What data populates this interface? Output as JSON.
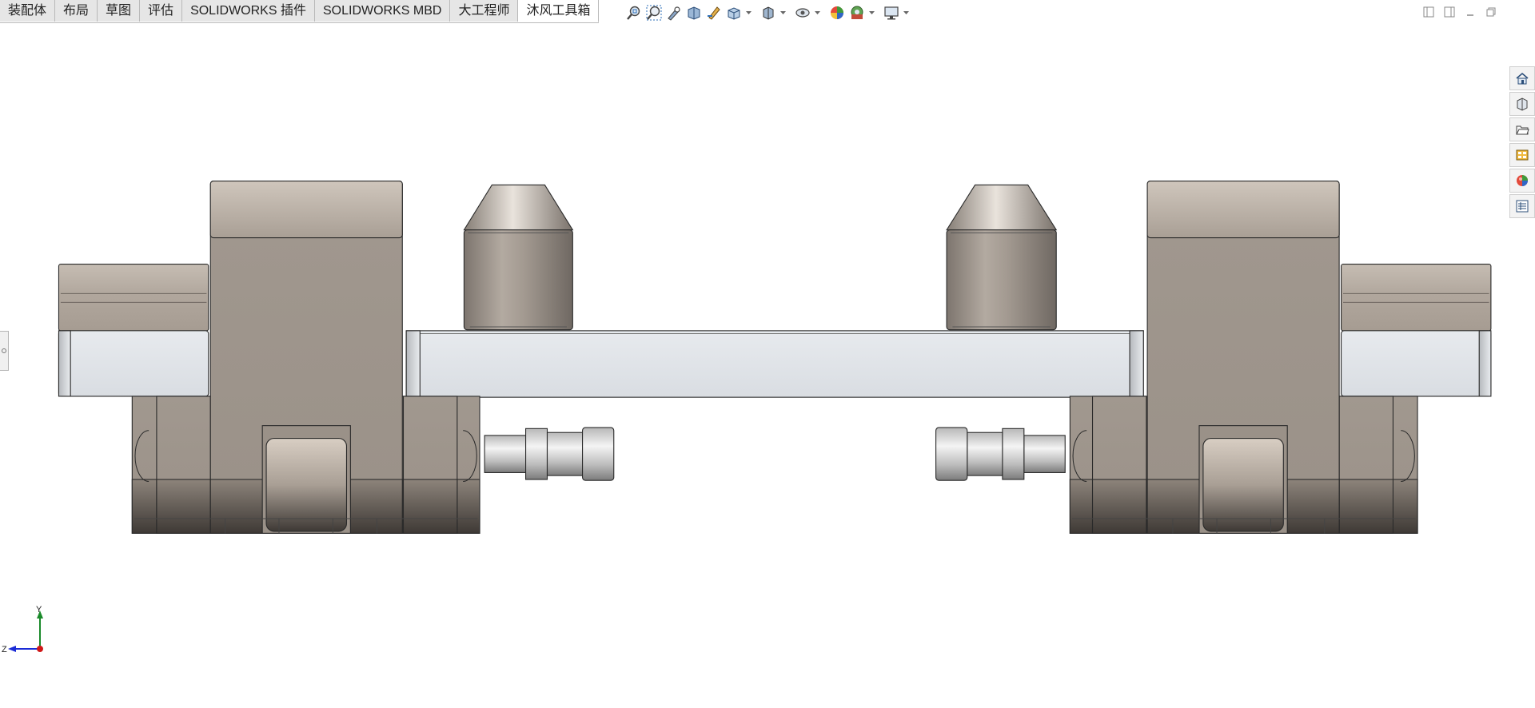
{
  "command_manager": {
    "tabs": [
      {
        "label": "装配体",
        "active": false
      },
      {
        "label": "布局",
        "active": false
      },
      {
        "label": "草图",
        "active": false
      },
      {
        "label": "评估",
        "active": false
      },
      {
        "label": "SOLIDWORKS 插件",
        "active": false
      },
      {
        "label": "SOLIDWORKS MBD",
        "active": false
      },
      {
        "label": "大工程师",
        "active": false
      },
      {
        "label": "沐风工具箱",
        "active": true
      }
    ]
  },
  "heads_up_toolbar": {
    "items": [
      {
        "icon": "zoom-to-fit-icon"
      },
      {
        "icon": "zoom-to-area-icon"
      },
      {
        "icon": "previous-view-icon"
      },
      {
        "icon": "section-view-icon"
      },
      {
        "icon": "dynamic-annotation-views-icon"
      },
      {
        "icon": "view-orientation-icon",
        "dropdown": true
      },
      {
        "icon": "display-style-icon",
        "dropdown": true
      },
      {
        "icon": "hide-show-items-icon",
        "dropdown": true
      },
      {
        "icon": "edit-appearance-icon"
      },
      {
        "icon": "apply-scene-icon",
        "dropdown": true
      },
      {
        "icon": "view-settings-icon",
        "dropdown": true
      }
    ]
  },
  "window_controls": [
    "tile-left-icon",
    "tile-right-icon",
    "minimize-icon",
    "restore-icon"
  ],
  "task_pane": [
    "solidworks-resources-icon",
    "design-library-icon",
    "file-explorer-icon",
    "view-palette-icon",
    "appearances-scenes-icon",
    "custom-properties-icon"
  ],
  "triad": {
    "y_label": "Y",
    "z_label": "Z"
  },
  "colors": {
    "tab_bg": "#e6e6e6",
    "tab_active_bg": "#ffffff",
    "body_tan": "#a59b91",
    "body_top": "#c3b9ae",
    "bar_face": "#dfe2e6",
    "edge": "#2a2a2a"
  }
}
